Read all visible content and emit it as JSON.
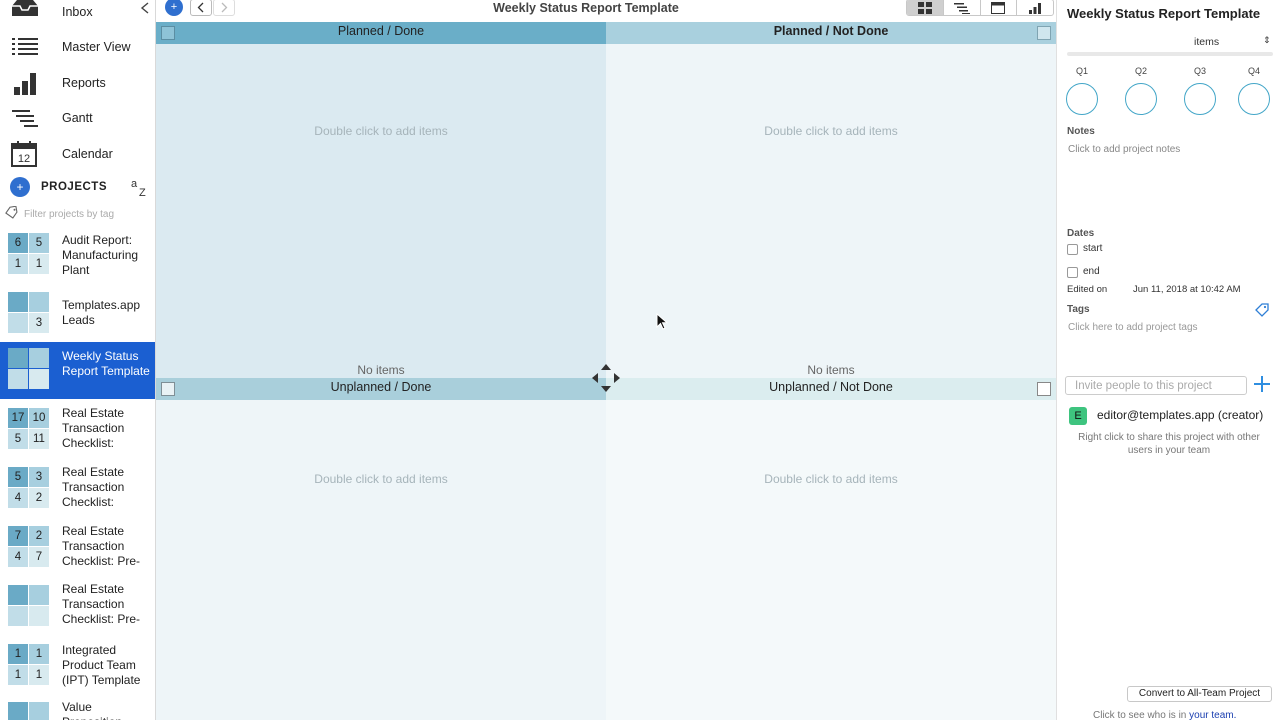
{
  "window_title": "Weekly Status Report Template",
  "nav": [
    {
      "label": "Inbox"
    },
    {
      "label": "Master View"
    },
    {
      "label": "Reports"
    },
    {
      "label": "Gantt"
    },
    {
      "label": "Calendar"
    }
  ],
  "calendar_icon_text": "12",
  "projects": {
    "header": "PROJECTS",
    "add_label": "+",
    "filter_placeholder": "Filter projects by tag",
    "items": [
      {
        "name": "Audit Report: Manufacturing Plant",
        "counts": [
          "6",
          "5",
          "1",
          "1"
        ],
        "selected": false
      },
      {
        "name": "Templates.app Leads",
        "counts": [
          "",
          "",
          "",
          "3"
        ],
        "selected": false
      },
      {
        "name": "Weekly Status Report Template",
        "counts": [
          "",
          "",
          "",
          ""
        ],
        "selected": true
      },
      {
        "name": "Real Estate Transaction Checklist:",
        "counts": [
          "17",
          "10",
          "5",
          "11"
        ],
        "selected": false
      },
      {
        "name": "Real Estate Transaction Checklist:",
        "counts": [
          "5",
          "3",
          "4",
          "2"
        ],
        "selected": false
      },
      {
        "name": "Real Estate Transaction Checklist: Pre-",
        "counts": [
          "7",
          "2",
          "4",
          "7"
        ],
        "selected": false
      },
      {
        "name": "Real Estate Transaction Checklist: Pre-",
        "counts": [
          "",
          "",
          "",
          ""
        ],
        "selected": false
      },
      {
        "name": "Integrated Product Team (IPT) Template",
        "counts": [
          "1",
          "1",
          "1",
          "1"
        ],
        "selected": false
      },
      {
        "name": "Value Proposition",
        "counts": [
          "",
          "",
          "",
          ""
        ],
        "selected": false
      }
    ]
  },
  "toolbar": {
    "add_label": "+"
  },
  "quadrants": [
    {
      "title": "Planned / Done",
      "hint": "Double click to add items",
      "empty": "No items"
    },
    {
      "title": "Planned / Not Done",
      "hint": "Double click to add items",
      "empty": "No items"
    },
    {
      "title": "Unplanned / Done",
      "hint": "Double click to add items"
    },
    {
      "title": "Unplanned / Not Done",
      "hint": "Double click to add items"
    }
  ],
  "panel": {
    "title": "Weekly Status Report Template",
    "unit": "items",
    "quarters": [
      "Q1",
      "Q2",
      "Q3",
      "Q4"
    ],
    "notes_label": "Notes",
    "notes_hint": "Click to add project notes",
    "dates_label": "Dates",
    "start_label": "start",
    "end_label": "end",
    "edited_label": "Edited on",
    "edited_value": "Jun 11, 2018 at 10:42 AM",
    "tags_label": "Tags",
    "tags_hint": "Click here to add project tags",
    "invite_placeholder": "Invite people to this project",
    "member_initial": "E",
    "member_email": "editor@templates.app (creator)",
    "share_hint": "Right click to share this project with other users in your team",
    "convert_label": "Convert to All-Team Project",
    "team_hint_prefix": "Click to see who is in ",
    "team_hint_link": "your team."
  },
  "colors": {
    "accent": "#1b5fd1",
    "quadrant_header_planned_done": "#6aaec8",
    "quadrant_header_planned_not_done": "#a9d0de",
    "member_avatar": "#3ec47f"
  }
}
